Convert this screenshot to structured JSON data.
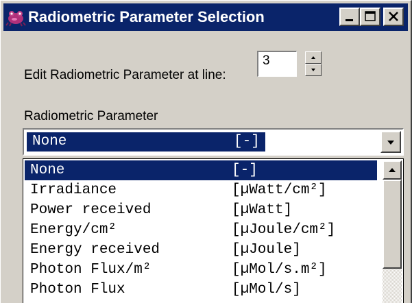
{
  "window": {
    "title": "Radiometric Parameter Selection",
    "app_icon": "frog-icon",
    "controls": [
      "minimize-icon",
      "maximize-icon",
      "close-icon"
    ]
  },
  "line_editor": {
    "label": "Edit Radiometric Parameter at line:",
    "value": "3"
  },
  "parameter": {
    "label": "Radiometric Parameter",
    "selected_name": "None",
    "selected_unit": "[-]"
  },
  "dropdown": {
    "items": [
      {
        "name": "None",
        "unit": "[-]",
        "selected": true
      },
      {
        "name": "Irradiance",
        "unit": "[µWatt/cm²]"
      },
      {
        "name": "Power received",
        "unit": "[µWatt]"
      },
      {
        "name": "Energy/cm²",
        "unit": "[µJoule/cm²]"
      },
      {
        "name": "Energy received",
        "unit": "[µJoule]"
      },
      {
        "name": "Photon Flux/m²",
        "unit": "[µMol/s.m²]"
      },
      {
        "name": "Photon Flux",
        "unit": "[µMol/s]"
      }
    ]
  },
  "colors": {
    "titlebar": "#0a246a",
    "highlight": "#0a246a",
    "face": "#d4d0c8"
  }
}
